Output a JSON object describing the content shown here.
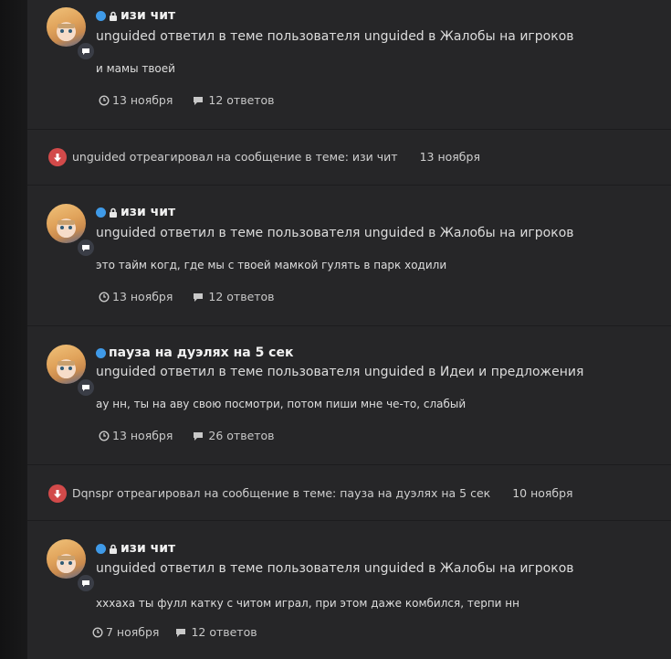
{
  "posts": [
    {
      "title": "изи чит",
      "locked": true,
      "description": "unguided ответил в теме пользователя unguided в Жалобы на игроков",
      "snippet": "и мамы твоей",
      "date": "13 ноября",
      "replies": "12 ответов"
    },
    {
      "title": "изи чит",
      "locked": true,
      "description": "unguided ответил в теме пользователя unguided в Жалобы на игроков",
      "snippet": "это тайм когд, где мы с твоей мамкой гулять в парк ходили",
      "date": "13 ноября",
      "replies": "12 ответов"
    },
    {
      "title": "пауза на дуэлях на 5 сек",
      "locked": false,
      "description": "unguided ответил в теме пользователя unguided в Идеи и предложения",
      "snippet": "ау нн, ты на аву свою посмотри, потом пиши мне че-то, слабый",
      "date": "13 ноября",
      "replies": "26 ответов"
    },
    {
      "title": "изи чит",
      "locked": true,
      "description": "unguided ответил в теме пользователя unguided в Жалобы на игроков",
      "snippet": "хххаха ты фулл катку с читом играл, при этом даже комбился, терпи нн",
      "date": "7 ноября",
      "replies": "12 ответов"
    }
  ],
  "reactions": [
    {
      "text": "unguided отреагировал на сообщение в теме: изи чит",
      "date": "13 ноября"
    },
    {
      "text": "Dqnspr отреагировал на сообщение в теме: пауза на дуэлях на 5 сек",
      "date": "10 ноября"
    }
  ],
  "colors": {
    "background": "#262628",
    "unread_dot": "#3f9ae8",
    "downvote": "#d24a4a"
  },
  "icons": {
    "badge": "comment-icon",
    "date": "clock-icon",
    "replies": "comments-icon",
    "reaction": "downvote-icon",
    "lock": "lock-icon"
  }
}
